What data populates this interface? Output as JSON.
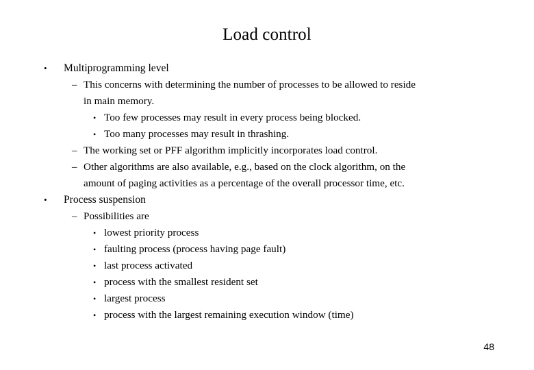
{
  "slide": {
    "title": "Load control",
    "page_number": "48",
    "markers": {
      "level1": "•",
      "level2": "–",
      "level3": "•"
    },
    "lines": [
      {
        "level": 1,
        "text": "Multiprogramming level"
      },
      {
        "level": 2,
        "text": "This concerns with determining the number of processes to be allowed to reside"
      },
      {
        "level": 0,
        "text": "in main memory."
      },
      {
        "level": 3,
        "text": "Too few processes may result in every process being blocked."
      },
      {
        "level": 3,
        "text": "Too many processes may result in thrashing."
      },
      {
        "level": 2,
        "text": "The working set or PFF algorithm implicitly incorporates load control."
      },
      {
        "level": 2,
        "text": "Other algorithms are also available, e.g., based on the clock algorithm, on the"
      },
      {
        "level": 0,
        "text": "amount of paging activities as a percentage of the overall processor time, etc."
      },
      {
        "level": 1,
        "text": "Process suspension"
      },
      {
        "level": 2,
        "text": "Possibilities are"
      },
      {
        "level": 3,
        "text": "lowest priority process"
      },
      {
        "level": 3,
        "text": "faulting process (process having page fault)"
      },
      {
        "level": 3,
        "text": "last process activated"
      },
      {
        "level": 3,
        "text": "process with the smallest resident set"
      },
      {
        "level": 3,
        "text": "largest process"
      },
      {
        "level": 3,
        "text": "process with the largest remaining execution window (time)"
      }
    ]
  }
}
